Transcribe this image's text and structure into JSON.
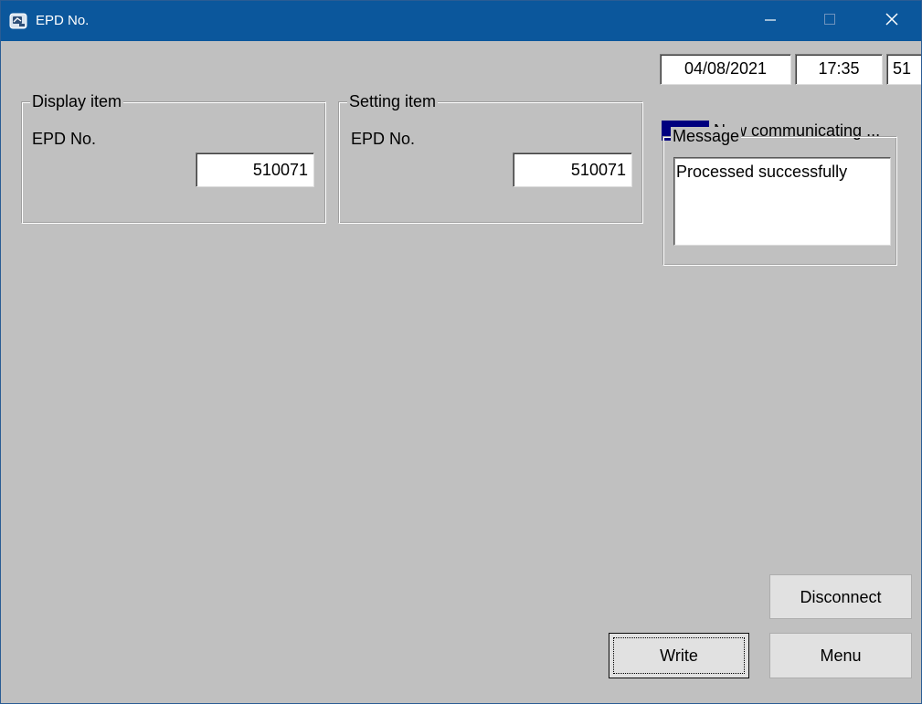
{
  "window": {
    "title": "EPD No."
  },
  "title_bar": {
    "icons": {
      "app": "app-icon",
      "minimize": "minimize-icon",
      "maximize": "maximize-icon",
      "close": "close-icon"
    }
  },
  "header": {
    "date": "04/08/2021",
    "time": "17:35",
    "extra": "51"
  },
  "status": {
    "text": "Now communicating ...",
    "indicator_color": "#00007f"
  },
  "display_item": {
    "legend": "Display item",
    "label": "EPD No.",
    "value": "510071"
  },
  "setting_item": {
    "legend": "Setting item",
    "label": "EPD No.",
    "value": "510071"
  },
  "message": {
    "legend": "Message",
    "text": "Processed successfully"
  },
  "buttons": {
    "disconnect": "Disconnect",
    "write": "Write",
    "menu": "Menu"
  },
  "colors": {
    "titlebar": "#0b579c",
    "background": "#c0c0c0"
  }
}
